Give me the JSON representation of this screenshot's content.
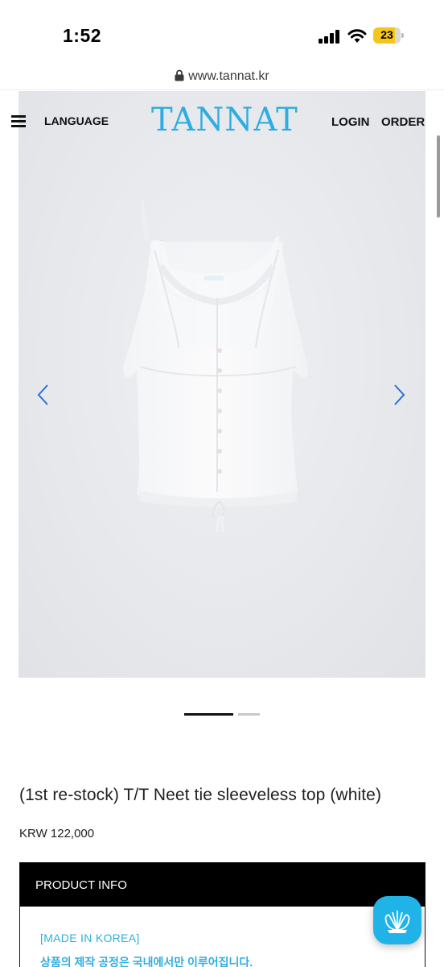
{
  "status_bar": {
    "time": "1:52",
    "battery_level": "23"
  },
  "browser": {
    "url": "www.tannat.kr"
  },
  "header": {
    "language": "LANGUAGE",
    "logo": "TANNAT",
    "login": "LOGIN",
    "order": "ORDER"
  },
  "carousel": {
    "current_slide": 1,
    "total_slides": 2
  },
  "product": {
    "title": "(1st re-stock) T/T Neet tie sleeveless top (white)",
    "price": "KRW 122,000"
  },
  "info": {
    "section_title": "PRODUCT INFO",
    "made_in": "[MADE IN KOREA]",
    "made_desc": "상품의 제작 공정은 국내에서만 이루어집니다."
  },
  "colors": {
    "accent": "#2eaee0",
    "chat_button": "#1fb3e8",
    "info_header": "#000000"
  },
  "icons": {
    "menu": "hamburger-menu-icon",
    "lock": "lock-icon",
    "prev": "chevron-left-icon",
    "next": "chevron-right-icon",
    "chat": "chat-logo-icon"
  }
}
